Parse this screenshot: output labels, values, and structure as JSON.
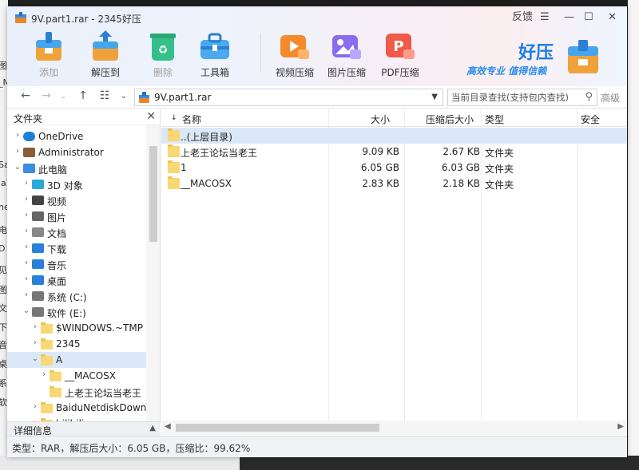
{
  "window": {
    "title": "9V.part1.rar - 2345好压",
    "feedback_label": "反馈"
  },
  "toolbar": {
    "add_label": "添加",
    "extract_label": "解压到",
    "delete_label": "删除",
    "toolbox_label": "工具箱",
    "video_label": "视频压缩",
    "image_label": "图片压缩",
    "pdf_label": "PDF压缩"
  },
  "brand": {
    "name": "好压",
    "slogan": "高效专业 值得信赖"
  },
  "nav": {
    "path": "9V.part1.rar",
    "search_placeholder": "当前目录查找(支持包内查找)",
    "advanced_label": "高级"
  },
  "tree": {
    "header": "文件夹",
    "items": [
      {
        "label": "OneDrive",
        "icon": "cloud-icon"
      },
      {
        "label": "Administrator",
        "icon": "user-icon"
      },
      {
        "label": "此电脑",
        "icon": "computer-icon"
      },
      {
        "label": "3D 对象",
        "icon": "cube-icon"
      },
      {
        "label": "视频",
        "icon": "video-icon"
      },
      {
        "label": "图片",
        "icon": "picture-icon"
      },
      {
        "label": "文档",
        "icon": "document-icon"
      },
      {
        "label": "下载",
        "icon": "download-icon"
      },
      {
        "label": "音乐",
        "icon": "music-icon"
      },
      {
        "label": "桌面",
        "icon": "desktop-icon"
      },
      {
        "label": "系统 (C:)",
        "icon": "drive-icon"
      },
      {
        "label": "软件 (E:)",
        "icon": "drive-icon"
      },
      {
        "label": "$WINDOWS.~TMP",
        "icon": "folder-icon"
      },
      {
        "label": "2345",
        "icon": "folder-icon"
      },
      {
        "label": "A",
        "icon": "folder-icon"
      },
      {
        "label": "__MACOSX",
        "icon": "folder-icon"
      },
      {
        "label": "上老王论坛当老王",
        "icon": "folder-icon"
      },
      {
        "label": "BaiduNetdiskDownl",
        "icon": "folder-icon"
      },
      {
        "label": "bilibili",
        "icon": "folder-icon"
      }
    ],
    "detail_label": "详细信息"
  },
  "columns": {
    "name": "名称",
    "size": "大小",
    "compressed": "压缩后大小",
    "type": "类型",
    "security": "安全"
  },
  "files": [
    {
      "name": "..(上层目录)",
      "size": "",
      "compressed": "",
      "type": ""
    },
    {
      "name": "上老王论坛当老王",
      "size": "9.09 KB",
      "compressed": "2.67 KB",
      "type": "文件夹"
    },
    {
      "name": "1",
      "size": "6.05 GB",
      "compressed": "6.03 GB",
      "type": "文件夹"
    },
    {
      "name": "__MACOSX",
      "size": "2.83 KB",
      "compressed": "2.18 KB",
      "type": "文件夹"
    }
  ],
  "status": {
    "text": "类型：RAR，解压后大小：6.05 GB，压缩比：99.62%"
  },
  "background": {
    "left_fragments": [
      "图",
      "_M",
      "Sa",
      "la",
      "ne",
      "电",
      "D",
      "见",
      "图",
      "文",
      "下",
      "音",
      "桌",
      "系",
      "软"
    ]
  },
  "colors": {
    "accent": "#1a7ee6",
    "selection": "#dbe8f7",
    "folder": "#f8d775"
  }
}
